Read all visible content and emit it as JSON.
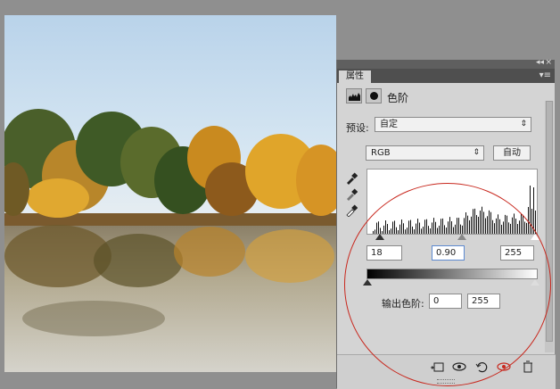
{
  "panel": {
    "tab_label": "属性",
    "title": "色阶",
    "preset_label": "预设:",
    "preset_value": "自定",
    "channel_value": "RGB",
    "auto_label": "自动",
    "input_black": "18",
    "input_gamma": "0.90",
    "input_white": "255",
    "output_label": "输出色阶:",
    "output_black": "0",
    "output_white": "255"
  },
  "colors": {
    "accent_red": "#c8281e",
    "panel_bg": "#d4d4d4"
  },
  "icons": [
    "levels-icon",
    "mask-icon",
    "black-eyedropper-icon",
    "gray-eyedropper-icon",
    "white-eyedropper-icon",
    "clip-layer-icon",
    "visibility-eye-icon",
    "reset-icon",
    "toggle-visibility-icon",
    "trash-icon"
  ]
}
